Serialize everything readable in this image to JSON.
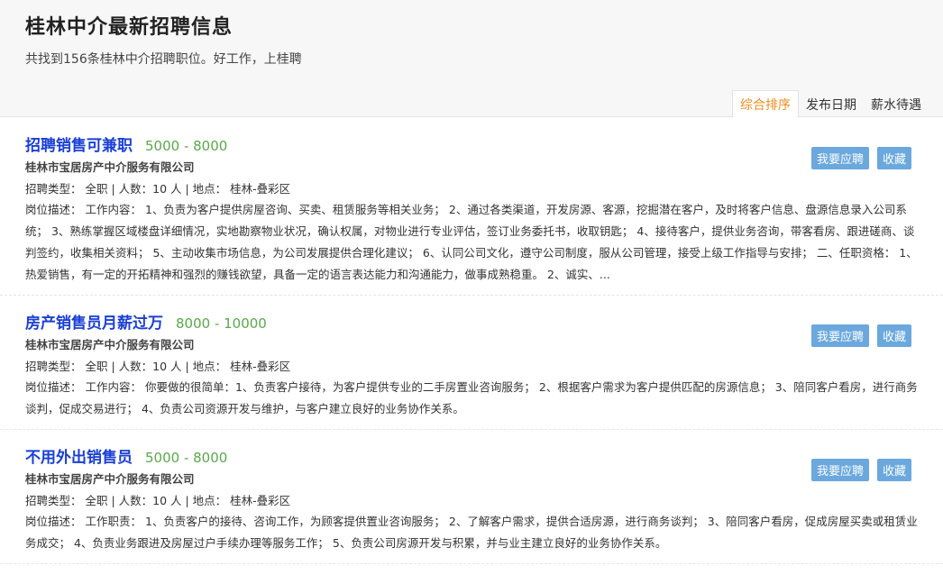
{
  "header": {
    "title": "桂林中介最新招聘信息",
    "subtitle": "共找到156条桂林中介招聘职位。好工作，上桂聘"
  },
  "sort_tabs": [
    {
      "label": "综合排序",
      "active": true
    },
    {
      "label": "发布日期",
      "active": false
    },
    {
      "label": "薪水待遇",
      "active": false
    }
  ],
  "jobs": [
    {
      "title": "招聘销售可兼职",
      "salary": "5000 - 8000",
      "company": "桂林市宝居房产中介服务有限公司",
      "meta": "招聘类型： 全职 | 人数：10 人 | 地点： 桂林-叠彩区",
      "desc": "岗位描述： 工作内容： 1、负责为客户提供房屋咨询、买卖、租赁服务等相关业务； 2、通过各类渠道，开发房源、客源，挖掘潜在客户，及时将客户信息、盘源信息录入公司系统； 3、熟练掌握区域楼盘详细情况，实地勘察物业状况，确认权属，对物业进行专业评估，签订业务委托书，收取钥匙； 4、接待客户，提供业务咨询，带客看房、跟进磋商、谈判签约，收集相关资料； 5、主动收集市场信息，为公司发展提供合理化建议； 6、认同公司文化，遵守公司制度，服从公司管理，接受上级工作指导与安排； 二、任职资格： 1、热爱销售，有一定的开拓精神和强烈的赚钱欲望，具备一定的语言表达能力和沟通能力，做事成熟稳重。 2、诚实、...",
      "apply_label": "我要应聘",
      "fav_label": "收藏"
    },
    {
      "title": "房产销售员月薪过万",
      "salary": "8000 - 10000",
      "company": "桂林市宝居房产中介服务有限公司",
      "meta": "招聘类型： 全职 | 人数：10 人 | 地点： 桂林-叠彩区",
      "desc": "岗位描述： 工作内容： 你要做的很简单：1、负责客户接待，为客户提供专业的二手房置业咨询服务； 2、根据客户需求为客户提供匹配的房源信息； 3、陪同客户看房，进行商务谈判，促成交易进行； 4、负责公司资源开发与维护，与客户建立良好的业务协作关系。",
      "apply_label": "我要应聘",
      "fav_label": "收藏"
    },
    {
      "title": "不用外出销售员",
      "salary": "5000 - 8000",
      "company": "桂林市宝居房产中介服务有限公司",
      "meta": "招聘类型： 全职 | 人数：10 人 | 地点： 桂林-叠彩区",
      "desc": "岗位描述： 工作职责： 1、负责客户的接待、咨询工作，为顾客提供置业咨询服务； 2、了解客户需求，提供合适房源，进行商务谈判； 3、陪同客户看房，促成房屋买卖或租赁业务成交； 4、负责业务跟进及房屋过户手续办理等服务工作； 5、负责公司房源开发与积累，并与业主建立良好的业务协作关系。",
      "apply_label": "我要应聘",
      "fav_label": "收藏"
    }
  ]
}
